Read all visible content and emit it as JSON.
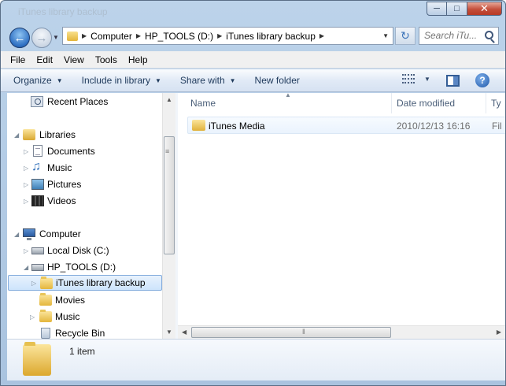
{
  "window": {
    "title": "iTunes library backup"
  },
  "nav": {
    "back_glyph": "←",
    "forward_glyph": "→",
    "breadcrumbs": [
      "Computer",
      "HP_TOOLS (D:)",
      "iTunes library backup"
    ],
    "search_placeholder": "Search iTu..."
  },
  "menu": [
    "File",
    "Edit",
    "View",
    "Tools",
    "Help"
  ],
  "toolbar": {
    "organize": "Organize",
    "include_in_library": "Include in library",
    "share_with": "Share with",
    "new_folder": "New folder"
  },
  "tree": [
    {
      "label": "Recent Places",
      "icon": "recent-places-icon"
    },
    {
      "label": "Libraries",
      "icon": "libraries-icon"
    },
    {
      "label": "Documents",
      "icon": "documents-icon"
    },
    {
      "label": "Music",
      "icon": "music-icon"
    },
    {
      "label": "Pictures",
      "icon": "pictures-icon"
    },
    {
      "label": "Videos",
      "icon": "videos-icon"
    },
    {
      "label": "Computer",
      "icon": "computer-icon"
    },
    {
      "label": "Local Disk (C:)",
      "icon": "local-disk-icon"
    },
    {
      "label": "HP_TOOLS (D:)",
      "icon": "removable-disk-icon"
    },
    {
      "label": "iTunes library backup",
      "icon": "folder-icon",
      "selected": true
    },
    {
      "label": "Movies",
      "icon": "folder-icon"
    },
    {
      "label": "Music",
      "icon": "folder-icon"
    },
    {
      "label": "Recycle Bin",
      "icon": "recycle-bin-icon"
    }
  ],
  "columns": {
    "name": "Name",
    "date_modified": "Date modified",
    "type": "Ty"
  },
  "files": [
    {
      "name": "iTunes Media",
      "date_modified": "2010/12/13 16:16",
      "type": "Fil"
    }
  ],
  "status": {
    "item_count": "1 item"
  }
}
